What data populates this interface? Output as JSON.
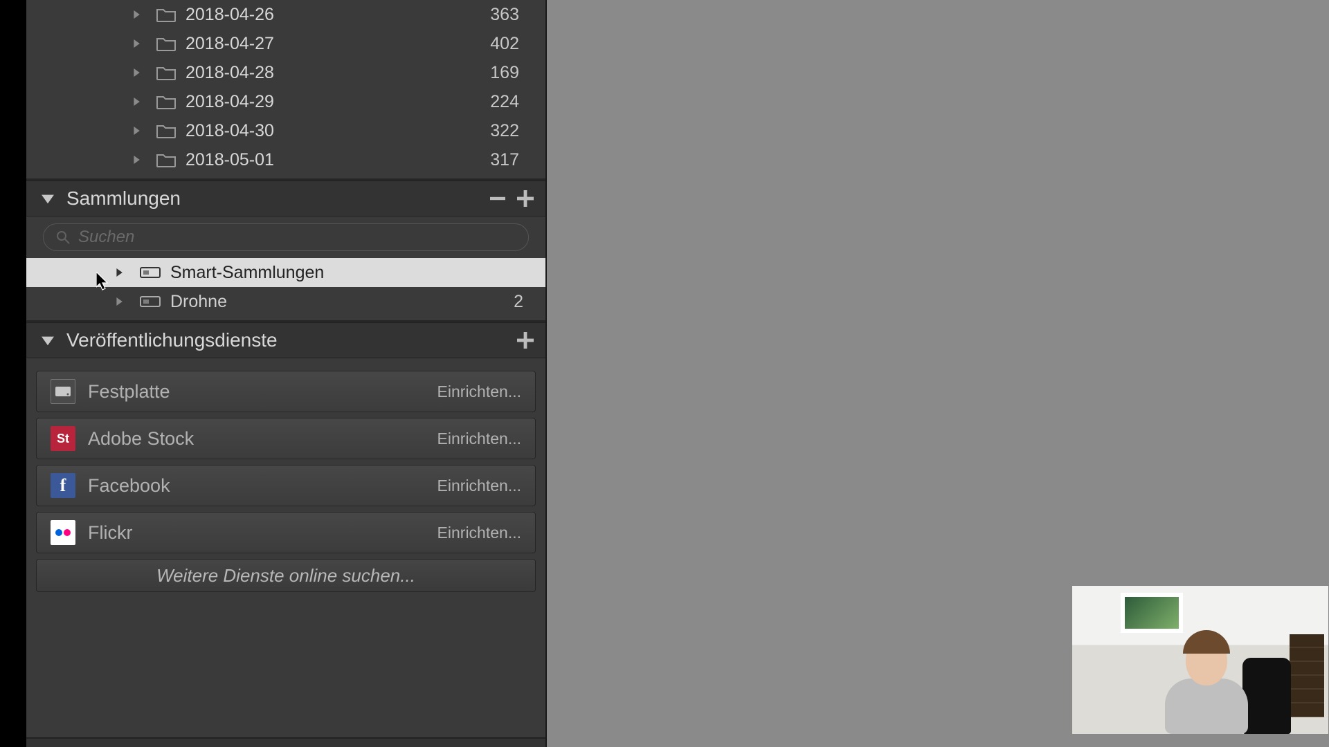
{
  "folders": [
    {
      "label": "2018-04-26",
      "count": "363"
    },
    {
      "label": "2018-04-27",
      "count": "402"
    },
    {
      "label": "2018-04-28",
      "count": "169"
    },
    {
      "label": "2018-04-29",
      "count": "224"
    },
    {
      "label": "2018-04-30",
      "count": "322"
    },
    {
      "label": "2018-05-01",
      "count": "317"
    }
  ],
  "collections": {
    "header": "Sammlungen",
    "search_placeholder": "Suchen",
    "items": [
      {
        "label": "Smart-Sammlungen",
        "count": "",
        "selected": true
      },
      {
        "label": "Drohne",
        "count": "2",
        "selected": false
      }
    ]
  },
  "publish": {
    "header": "Veröffentlichungsdienste",
    "setup_label": "Einrichten...",
    "services": [
      {
        "label": "Festplatte",
        "icon": "hdd"
      },
      {
        "label": "Adobe Stock",
        "icon": "adobestock"
      },
      {
        "label": "Facebook",
        "icon": "facebook"
      },
      {
        "label": "Flickr",
        "icon": "flickr"
      }
    ],
    "more_label": "Weitere Dienste online suchen..."
  }
}
